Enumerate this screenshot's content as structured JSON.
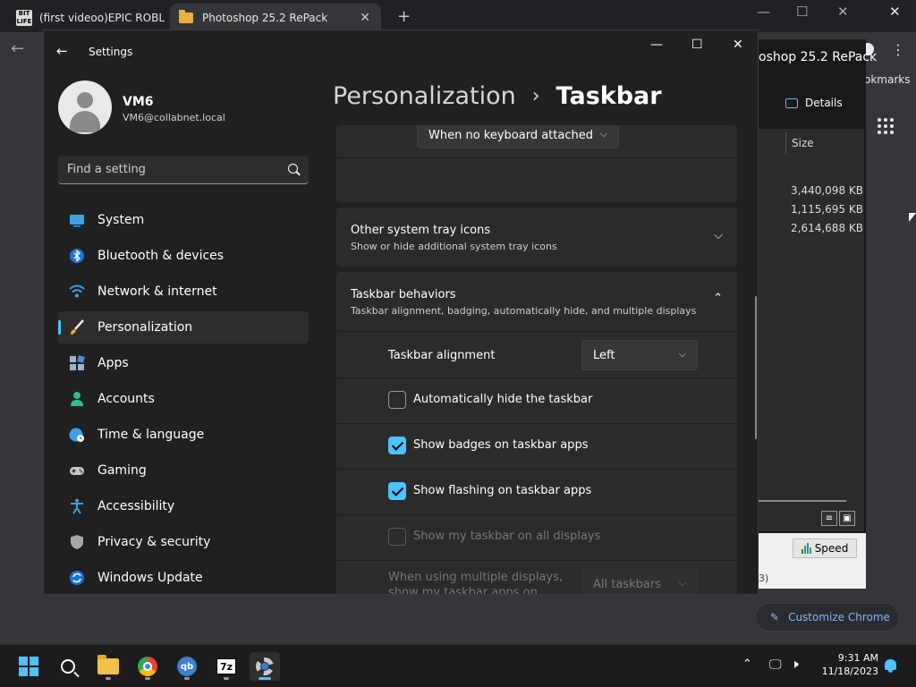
{
  "chrome": {
    "tab1_favicon_text": "BIT LIFE",
    "tab1_title": "(first videoo)EPIC ROBLOX",
    "tab2_title": "Photoshop 25.2 RePack",
    "tab_close": "✕",
    "new_tab": "+",
    "bookmarks_text": "okmarks",
    "customize_label": "Customize Chrome"
  },
  "explorer": {
    "title": "oshop 25.2 RePack",
    "details_label": "Details",
    "size_header": "Size",
    "sizes": [
      "3,440,098 KB",
      "1,115,695 KB",
      "2,614,688 KB"
    ],
    "speed_label": "Speed",
    "status_fragment": "3)"
  },
  "settings": {
    "window_title": "Settings",
    "user": {
      "name": "VM6",
      "email": "VM6@collabnet.local"
    },
    "search_placeholder": "Find a setting",
    "nav": [
      {
        "label": "System"
      },
      {
        "label": "Bluetooth & devices"
      },
      {
        "label": "Network & internet"
      },
      {
        "label": "Personalization"
      },
      {
        "label": "Apps"
      },
      {
        "label": "Accounts"
      },
      {
        "label": "Time & language"
      },
      {
        "label": "Gaming"
      },
      {
        "label": "Accessibility"
      },
      {
        "label": "Privacy & security"
      },
      {
        "label": "Windows Update"
      }
    ],
    "breadcrumb": {
      "parent": "Personalization",
      "separator": "›",
      "current": "Taskbar"
    },
    "keyboard_dropdown": "When no keyboard attached",
    "tray_icons": {
      "title": "Other system tray icons",
      "subtitle": "Show or hide additional system tray icons"
    },
    "behaviors": {
      "title": "Taskbar behaviors",
      "subtitle": "Taskbar alignment, badging, automatically hide, and multiple displays",
      "alignment_label": "Taskbar alignment",
      "alignment_value": "Left",
      "auto_hide": "Automatically hide the taskbar",
      "badges": "Show badges on taskbar apps",
      "flashing": "Show flashing on taskbar apps",
      "all_displays": "Show my taskbar on all displays",
      "multi_display_label": "When using multiple displays, show my taskbar apps on",
      "multi_display_value": "All taskbars"
    }
  },
  "taskbar": {
    "time": "9:31 AM",
    "date": "11/18/2023",
    "qb_text": "qb",
    "sevenzip_text": "7z"
  },
  "colors": {
    "accent": "#4cc2ff",
    "background": "#202020",
    "card": "#2b2b2b"
  }
}
